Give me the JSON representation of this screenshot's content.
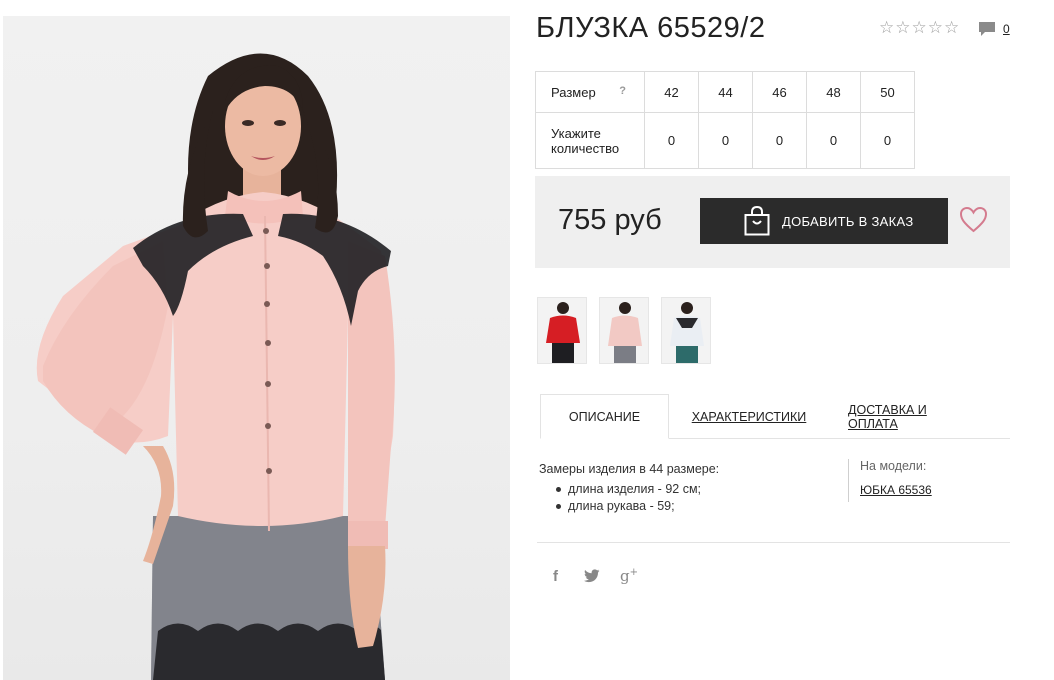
{
  "product": {
    "title": "БЛУЗКА 65529/2",
    "rating_stars": 5,
    "comments_count": "0",
    "price": "755 руб",
    "add_to_order_label": "ДОБАВИТЬ В ЗАКАЗ"
  },
  "sizes": {
    "size_label": "Размер",
    "help_mark": "?",
    "qty_label_line1": "Укажите",
    "qty_label_line2": "количество",
    "items": [
      {
        "size": "42",
        "qty": "0"
      },
      {
        "size": "44",
        "qty": "0"
      },
      {
        "size": "46",
        "qty": "0"
      },
      {
        "size": "48",
        "qty": "0"
      },
      {
        "size": "50",
        "qty": "0"
      }
    ]
  },
  "thumbnails": [
    {
      "name": "thumb-red",
      "color": "#d61e24"
    },
    {
      "name": "thumb-pink",
      "color": "#f2c9c4"
    },
    {
      "name": "thumb-white",
      "color": "#eaeef3"
    }
  ],
  "tabs": [
    {
      "label": "ОПИСАНИЕ",
      "active": true
    },
    {
      "label": "ХАРАКТЕРИСТИКИ",
      "active": false
    },
    {
      "label": "ДОСТАВКА И ОПЛАТА",
      "active": false
    }
  ],
  "description": {
    "intro": "Замеры изделия в 44 размере:",
    "bullets": [
      "длина изделия - 92 см;",
      "длина рукава - 59;"
    ],
    "on_model_label": "На модели:",
    "on_model_link": "ЮБКА 65536"
  },
  "social": {
    "facebook": "f",
    "googleplus": "g",
    "googleplus_sup": "+"
  },
  "colors": {
    "dark_button": "#2b2b2b",
    "panel_bg": "#efefef",
    "heart": "#d47b8e",
    "blouse_pink": "#f6cdc7"
  }
}
